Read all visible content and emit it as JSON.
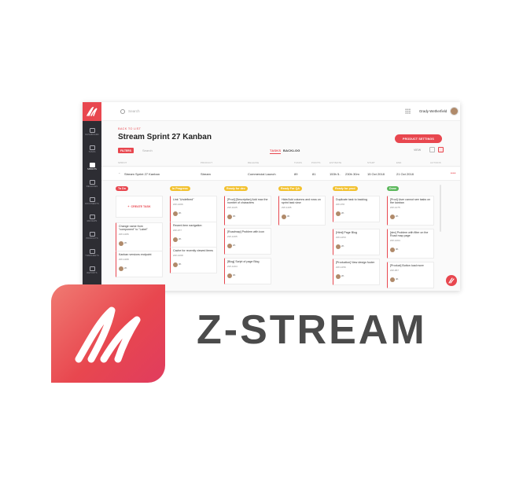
{
  "app": {
    "search_placeholder": "Search",
    "user_name": "Grady Wetherfield"
  },
  "sidebar": {
    "items": [
      {
        "label": "Dashboard",
        "icon": "dashboard-icon"
      },
      {
        "label": "Tasks",
        "icon": "tasks-icon"
      },
      {
        "label": "Sprints",
        "icon": "sprints-icon"
      },
      {
        "label": "Releases",
        "icon": "releases-icon"
      },
      {
        "label": "Documents",
        "icon": "documents-icon"
      },
      {
        "label": "Reviews",
        "icon": "reviews-icon"
      },
      {
        "label": "Products",
        "icon": "products-icon"
      },
      {
        "label": "Timesheets",
        "icon": "timesheets-icon"
      },
      {
        "label": "Reports",
        "icon": "reports-icon"
      }
    ]
  },
  "header": {
    "back_link": "BACK TO LIST",
    "title": "Stream Sprint 27 Kanban",
    "product_settings": "PRODUCT SETTINGS",
    "filters": "FILTERS",
    "search_placeholder": "Search",
    "tabs": [
      "TASKS",
      "BACKLOG"
    ],
    "view_label": "VIEW"
  },
  "table": {
    "columns": [
      "SPRINT",
      "PRODUCT",
      "RELEASE",
      "TASKS",
      "POINTS",
      "ESTIMATE",
      "START",
      "END",
      "ACTIONS"
    ],
    "row": {
      "sprint": "Stream Sprint 27 Kanban",
      "product": "Stream",
      "release": "Commercial Launch",
      "tasks": "89",
      "points": "81",
      "estimate": "153h 5..",
      "remaining": "230h 30m",
      "start": "15 Oct 2018",
      "end": "21 Oct 2018",
      "actions": "•••"
    }
  },
  "board": {
    "create_task": "CREATE TASK",
    "columns": [
      {
        "name": "To Do",
        "color": "#e8474f",
        "cards": [
          {
            "title": "Change name from \"component\" to \"Label\"",
            "id": "ZW-1286",
            "est": "2h"
          },
          {
            "title": "Kanban versions endpoint",
            "id": "ZW-1288",
            "est": "2h"
          }
        ]
      },
      {
        "name": "In Progress",
        "color": "#f2c12e",
        "cards": [
          {
            "title": "Link \"Undefined\"",
            "id": "ZW-1266",
            "est": "2h"
          },
          {
            "title": "Recent item navigation",
            "id": "ZW-977",
            "est": "2h"
          },
          {
            "title": "Cache for recently viewed items",
            "id": "ZW-1268",
            "est": "3h"
          }
        ]
      },
      {
        "name": "Ready for dev",
        "color": "#f2c12e",
        "cards": [
          {
            "title": "[Prod] [Description] Add max the number of characters",
            "id": "ZW-1025",
            "est": "3h"
          },
          {
            "title": "[Roadmap] Problem with icon",
            "id": "ZW-1265",
            "est": "2h"
          },
          {
            "title": "[Blog] Script of page Blog",
            "id": "ZW-1264",
            "est": "3h"
          }
        ]
      },
      {
        "name": "Ready For QA",
        "color": "#f2c12e",
        "cards": [
          {
            "title": "Hide/Add columns and rows on sprint task view",
            "id": "ZW-1165",
            "est": "3h"
          }
        ]
      },
      {
        "name": "Ready for prod",
        "color": "#f2c12e",
        "cards": [
          {
            "title": "Duplicate task to backlog",
            "id": "ZW-978",
            "est": "2h"
          },
          {
            "title": "[Html] Page Blog",
            "id": "ZW-1253",
            "est": "2h"
          },
          {
            "title": "[Production] New design footer",
            "id": "ZW-1256",
            "est": "2h"
          }
        ]
      },
      {
        "name": "Done",
        "color": "#5cb85c",
        "cards": [
          {
            "title": "[Prod] User cannot see tasks on the kanban",
            "id": "ZW-1275",
            "est": "2h"
          },
          {
            "title": "[dev] Problem with filter on the Road map page",
            "id": "ZW-1264",
            "est": "3h"
          },
          {
            "title": "[Product] Button load more",
            "id": "ZW-957",
            "est": "4h"
          }
        ]
      }
    ]
  },
  "brand": {
    "wordmark": "Z-STREAM",
    "accent": "#e8474f"
  }
}
